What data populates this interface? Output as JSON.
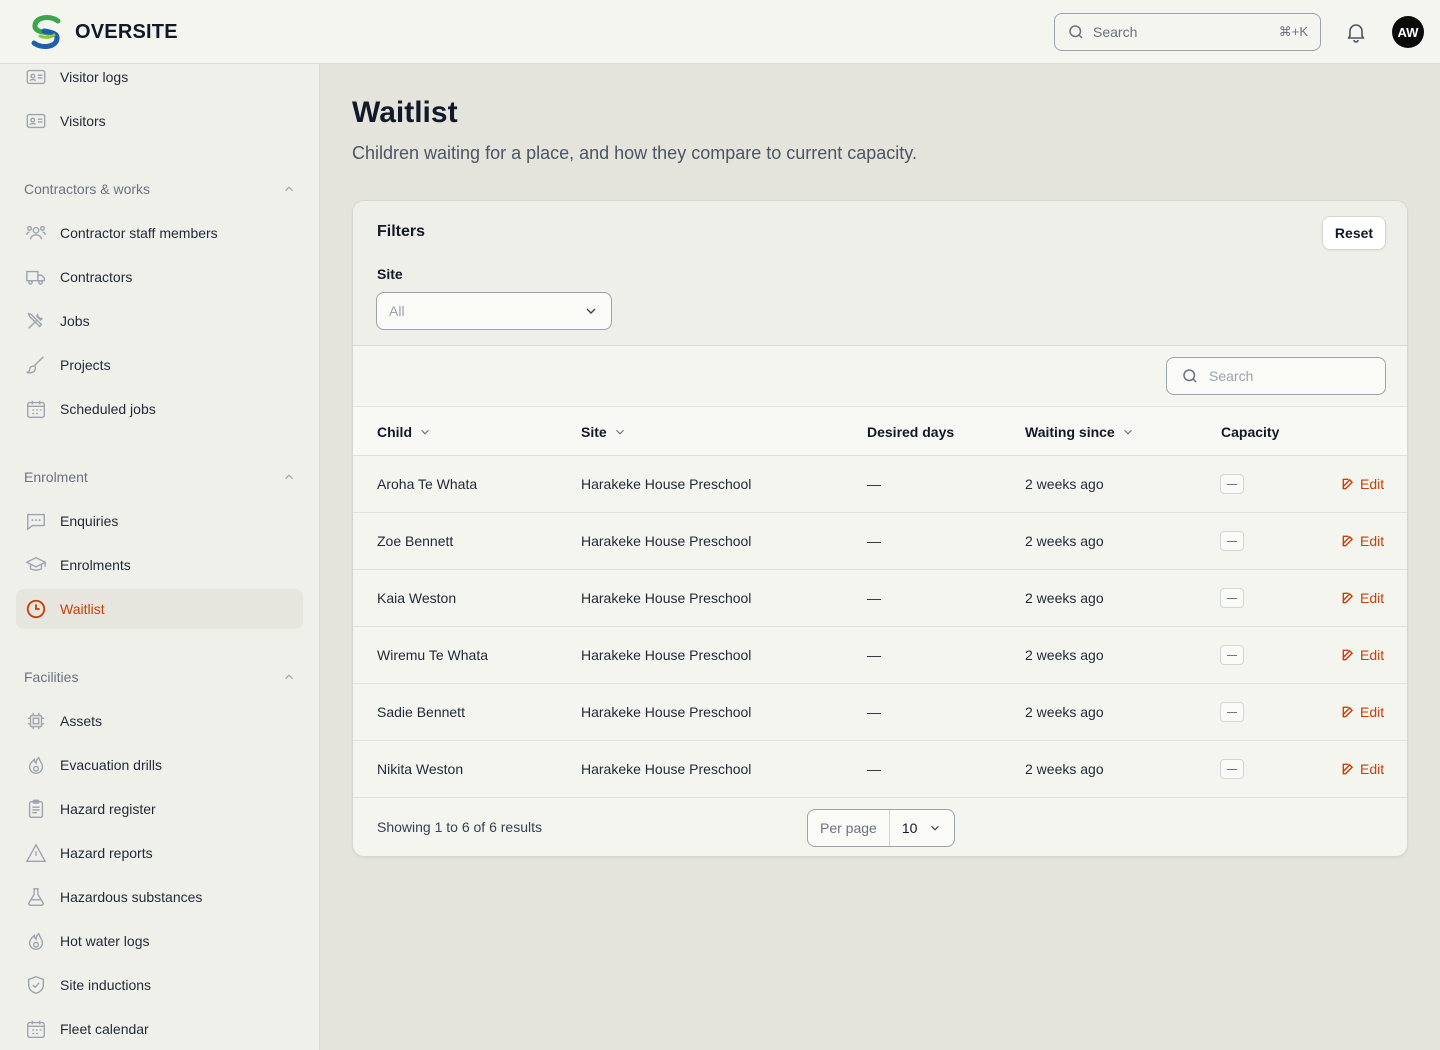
{
  "app": {
    "brand": "OVERSITE",
    "search_placeholder": "Search",
    "search_shortcut": "⌘+K",
    "avatar_initials": "AW",
    "accent_color": "#c2410c"
  },
  "sidebar": {
    "top_items": [
      {
        "label": "Visitor logs",
        "icon": "id-card-icon"
      },
      {
        "label": "Visitors",
        "icon": "id-card-icon"
      }
    ],
    "groups": [
      {
        "label": "Contractors & works",
        "items": [
          {
            "label": "Contractor staff members",
            "icon": "users-icon"
          },
          {
            "label": "Contractors",
            "icon": "truck-icon"
          },
          {
            "label": "Jobs",
            "icon": "tools-icon"
          },
          {
            "label": "Projects",
            "icon": "paintbrush-icon"
          },
          {
            "label": "Scheduled jobs",
            "icon": "calendar-icon"
          }
        ]
      },
      {
        "label": "Enrolment",
        "items": [
          {
            "label": "Enquiries",
            "icon": "chat-icon"
          },
          {
            "label": "Enrolments",
            "icon": "graduation-cap-icon"
          },
          {
            "label": "Waitlist",
            "icon": "clock-icon",
            "active": true
          }
        ]
      },
      {
        "label": "Facilities",
        "items": [
          {
            "label": "Assets",
            "icon": "chip-icon"
          },
          {
            "label": "Evacuation drills",
            "icon": "fire-icon"
          },
          {
            "label": "Hazard register",
            "icon": "clipboard-icon"
          },
          {
            "label": "Hazard reports",
            "icon": "warning-icon"
          },
          {
            "label": "Hazardous substances",
            "icon": "flask-icon"
          },
          {
            "label": "Hot water logs",
            "icon": "fire-icon"
          },
          {
            "label": "Site inductions",
            "icon": "shield-check-icon"
          },
          {
            "label": "Fleet calendar",
            "icon": "calendar-icon"
          }
        ]
      }
    ]
  },
  "page": {
    "title": "Waitlist",
    "subtitle": "Children waiting for a place, and how they compare to current capacity."
  },
  "filters": {
    "title": "Filters",
    "reset_label": "Reset",
    "site_label": "Site",
    "site_value": "All"
  },
  "table": {
    "search_placeholder": "Search",
    "columns": {
      "child": "Child",
      "site": "Site",
      "desired_days": "Desired days",
      "waiting_since": "Waiting since",
      "capacity": "Capacity"
    },
    "edit_label": "Edit",
    "rows": [
      {
        "child": "Aroha Te Whata",
        "site": "Harakeke House Preschool",
        "desired_days": "—",
        "waiting_since": "2 weeks ago"
      },
      {
        "child": "Zoe Bennett",
        "site": "Harakeke House Preschool",
        "desired_days": "—",
        "waiting_since": "2 weeks ago"
      },
      {
        "child": "Kaia Weston",
        "site": "Harakeke House Preschool",
        "desired_days": "—",
        "waiting_since": "2 weeks ago"
      },
      {
        "child": "Wiremu Te Whata",
        "site": "Harakeke House Preschool",
        "desired_days": "—",
        "waiting_since": "2 weeks ago"
      },
      {
        "child": "Sadie Bennett",
        "site": "Harakeke House Preschool",
        "desired_days": "—",
        "waiting_since": "2 weeks ago"
      },
      {
        "child": "Nikita Weston",
        "site": "Harakeke House Preschool",
        "desired_days": "—",
        "waiting_since": "2 weeks ago"
      }
    ],
    "footer": {
      "showing": "Showing 1 to 6 of 6 results",
      "per_page_label": "Per page",
      "per_page_value": "10"
    }
  }
}
